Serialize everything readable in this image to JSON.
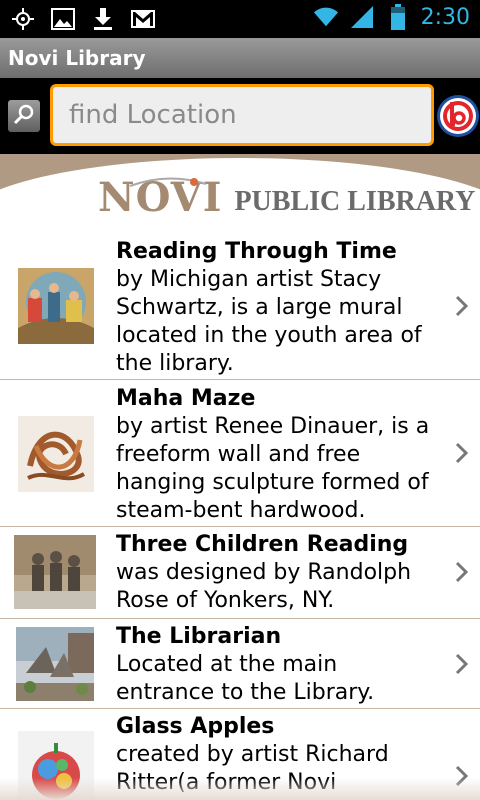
{
  "status_bar": {
    "icons": [
      "gps-icon",
      "image-icon",
      "download-icon",
      "gmail-icon",
      "wifi-icon",
      "signal-icon",
      "battery-icon"
    ],
    "time": "2:30",
    "accent_color": "#33b5e5"
  },
  "title_bar": {
    "title": "Novi Library"
  },
  "search": {
    "placeholder": "find Location",
    "value": "",
    "border_color": "#ff9a00"
  },
  "banner": {
    "logo_word": "NOVI",
    "logo_text": "PUBLIC LIBRARY"
  },
  "items": [
    {
      "title": "Reading Through Time",
      "description": "by Michigan artist Stacy Schwartz, is a large mural located in the youth area of the library."
    },
    {
      "title": "Maha Maze",
      "description": "by artist Renee Dinauer, is a freeform wall and free hanging sculpture formed of steam-bent hardwood."
    },
    {
      "title": "Three Children Reading",
      "description": "was designed by Randolph Rose of Yonkers, NY."
    },
    {
      "title": "The Librarian",
      "description": "Located at the main entrance to the Library."
    },
    {
      "title": "Glass Apples",
      "description": "created by artist Richard Ritter(a former Novi"
    }
  ]
}
